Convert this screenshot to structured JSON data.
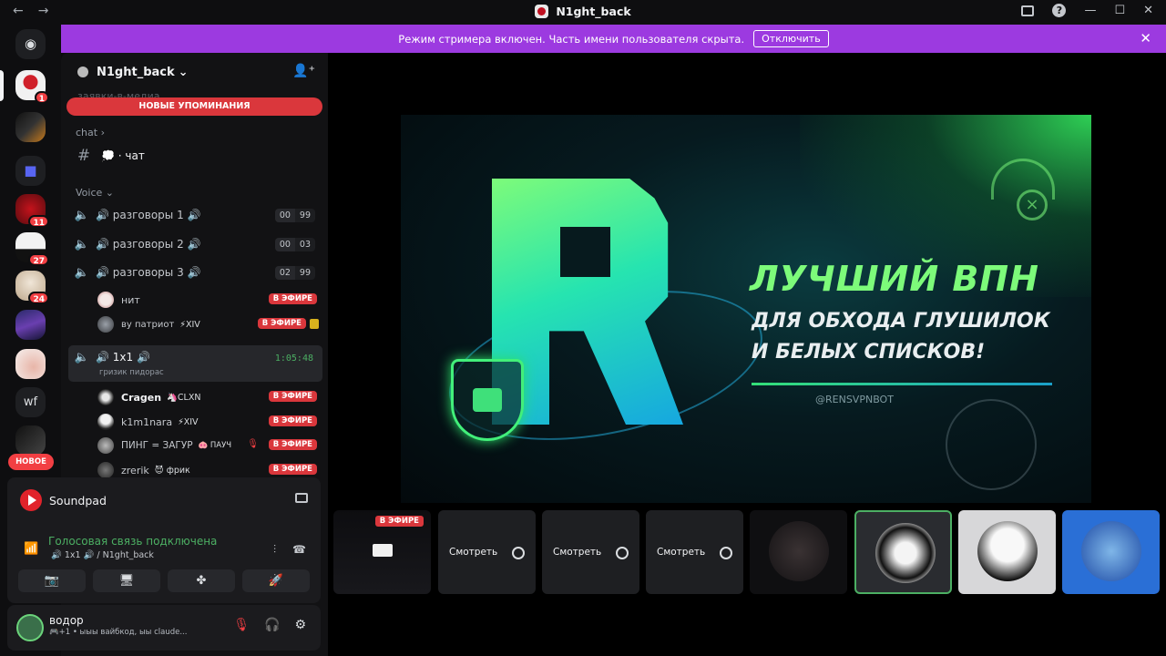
{
  "window": {
    "title": "N1ght_back",
    "back": "←",
    "forward": "→",
    "help": "?",
    "minimize": "—",
    "maximize": "☐",
    "close": "✕"
  },
  "banner": {
    "text": "Режим стримера включен. Часть имени пользователя скрыта.",
    "button": "Отключить",
    "close": "✕"
  },
  "rail": {
    "new_label": "НОВОЕ",
    "wf_label": "wf",
    "counts": [
      "1",
      "11",
      "27",
      "24"
    ]
  },
  "server": {
    "name": "N1ght_back",
    "chevron": "⌄",
    "invite": "👤⁺"
  },
  "sidebar": {
    "ghost_channel": "заявки-в-медиа",
    "mentions": "НОВЫЕ УПОМИНАНИЯ",
    "cat_chat": "chat ›",
    "chat_channel": {
      "hash": "#",
      "name": "💭 · чат"
    },
    "cat_voice": "Voice ⌄",
    "voice": [
      {
        "name": "🔊 разговоры 1 🔊",
        "a": "00",
        "b": "99"
      },
      {
        "name": "🔊 разговоры 2 🔊",
        "a": "00",
        "b": "03"
      },
      {
        "name": "🔊 разговоры 3 🔊",
        "a": "02",
        "b": "99"
      }
    ],
    "users3": [
      {
        "name": "нит",
        "tag": "",
        "live": "В ЭФИРЕ"
      },
      {
        "name": "ву патриот",
        "tag": "⚡XIV",
        "live": "В ЭФИРЕ"
      }
    ],
    "active": {
      "name": "🔊 1x1 🔊",
      "time": "1:05:48",
      "sub": "гризик пидорас"
    },
    "users_active": [
      {
        "name": "Cragen",
        "tag": "🦄CLXN",
        "live": "В ЭФИРЕ"
      },
      {
        "name": "k1m1nara",
        "tag": "⚡XIV",
        "live": "В ЭФИРЕ"
      },
      {
        "name": "ПИНГ = ЗАГУР",
        "tag": "🐽 ПАУЧ",
        "live": "В ЭФИРЕ"
      },
      {
        "name": "zrerik",
        "tag": "😈 фрик",
        "live": "В ЭФИРЕ"
      }
    ]
  },
  "panel": {
    "app_name": "Soundpad",
    "voice_status": "Голосовая связь подключена",
    "voice_channel": "🔊 1x1 🔊 / N1ght_back",
    "buttons": [
      "📷",
      "🖥",
      "✤",
      "🚀"
    ]
  },
  "me": {
    "name": "водор",
    "status": "🎮+1 • ыыы вайбкод, ыы claude...",
    "mic": "🎙",
    "headset": "🎧",
    "settings": "⚙"
  },
  "stream": {
    "line1": "ЛУЧШИЙ ВПН",
    "line2": "ДЛЯ ОБХОДА ГЛУШИЛОК",
    "line3": "И БЕЛЫХ СПИСКОВ!",
    "handle": "@RENSVPNBOT"
  },
  "tiles": {
    "live": "В ЭФИРЕ",
    "watch": "Смотреть"
  },
  "colors": {
    "accent_banner": "#9c3ae0",
    "live_red": "#da373c",
    "voice_green": "#4caf63"
  }
}
